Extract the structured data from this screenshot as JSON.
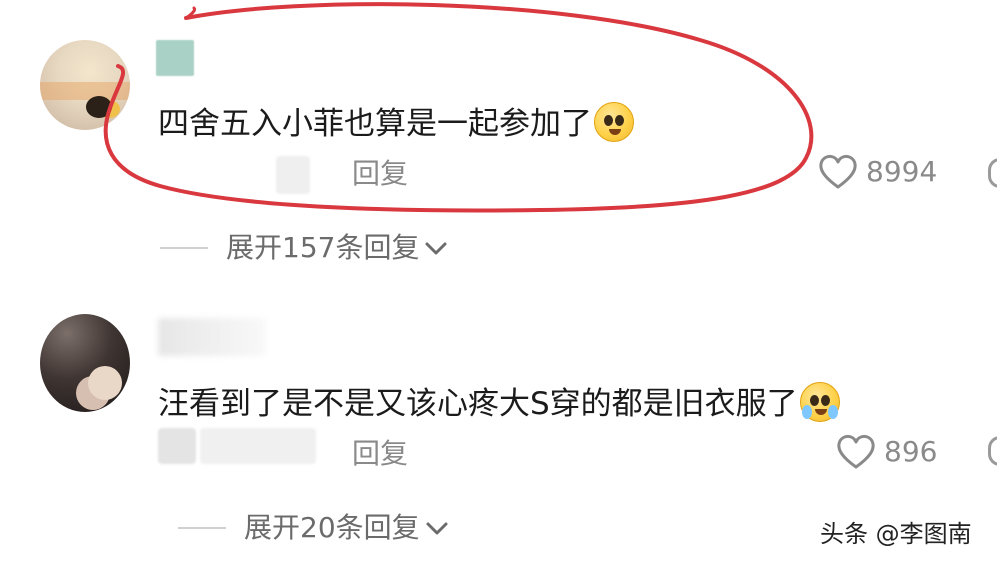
{
  "comments": [
    {
      "text": "四舍五入小菲也算是一起参加了",
      "emoji": "pleading-face-emoji",
      "reply_label": "回复",
      "likes": "8994",
      "expand_label": "展开157条回复"
    },
    {
      "text": "汪看到了是不是又该心疼大S穿的都是旧衣服了",
      "emoji": "crying-face-emoji",
      "reply_label": "回复",
      "likes": "896",
      "expand_label": "展开20条回复"
    }
  ],
  "annotation": {
    "color": "#d9383f",
    "shape": "hand-drawn-ellipse-around-first-comment"
  },
  "watermark": {
    "text": "头条 @李图南"
  },
  "colors": {
    "text_primary": "#1b1b1b",
    "text_secondary": "#8a8a8a",
    "background": "#ffffff"
  }
}
